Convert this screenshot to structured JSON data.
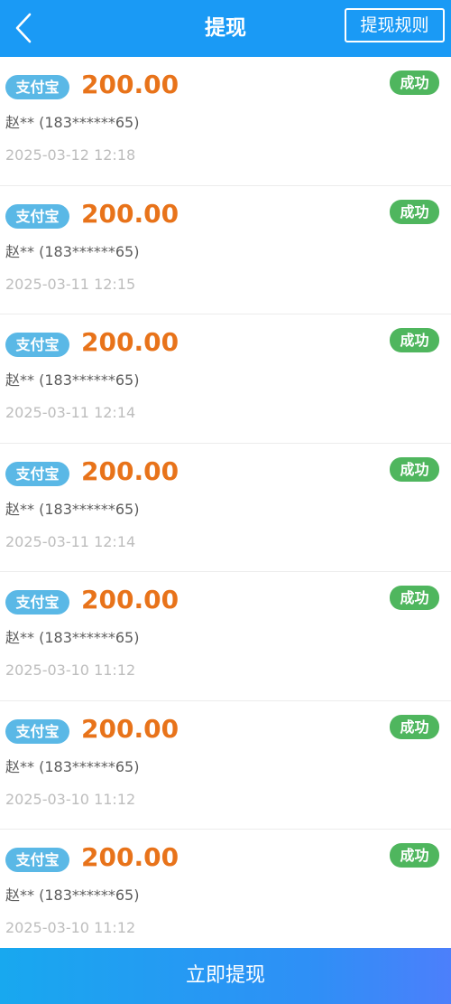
{
  "header": {
    "title": "提现",
    "rules_label": "提现规则",
    "back_icon": "chevron-left-icon"
  },
  "colors": {
    "header_bg": "#1a9af5",
    "amount": "#e8731a",
    "method_badge": "#5ab8e6",
    "status_badge": "#4fb65e"
  },
  "records": [
    {
      "method": "支付宝",
      "amount": "200.00",
      "status": "成功",
      "account": "赵** (183******65)",
      "time": "2025-03-12 12:18"
    },
    {
      "method": "支付宝",
      "amount": "200.00",
      "status": "成功",
      "account": "赵** (183******65)",
      "time": "2025-03-11 12:15"
    },
    {
      "method": "支付宝",
      "amount": "200.00",
      "status": "成功",
      "account": "赵** (183******65)",
      "time": "2025-03-11 12:14"
    },
    {
      "method": "支付宝",
      "amount": "200.00",
      "status": "成功",
      "account": "赵** (183******65)",
      "time": "2025-03-11 12:14"
    },
    {
      "method": "支付宝",
      "amount": "200.00",
      "status": "成功",
      "account": "赵** (183******65)",
      "time": "2025-03-10 11:12"
    },
    {
      "method": "支付宝",
      "amount": "200.00",
      "status": "成功",
      "account": "赵** (183******65)",
      "time": "2025-03-10 11:12"
    },
    {
      "method": "支付宝",
      "amount": "200.00",
      "status": "成功",
      "account": "赵** (183******65)",
      "time": "2025-03-10 11:12"
    }
  ],
  "footer": {
    "withdraw_label": "立即提现"
  }
}
